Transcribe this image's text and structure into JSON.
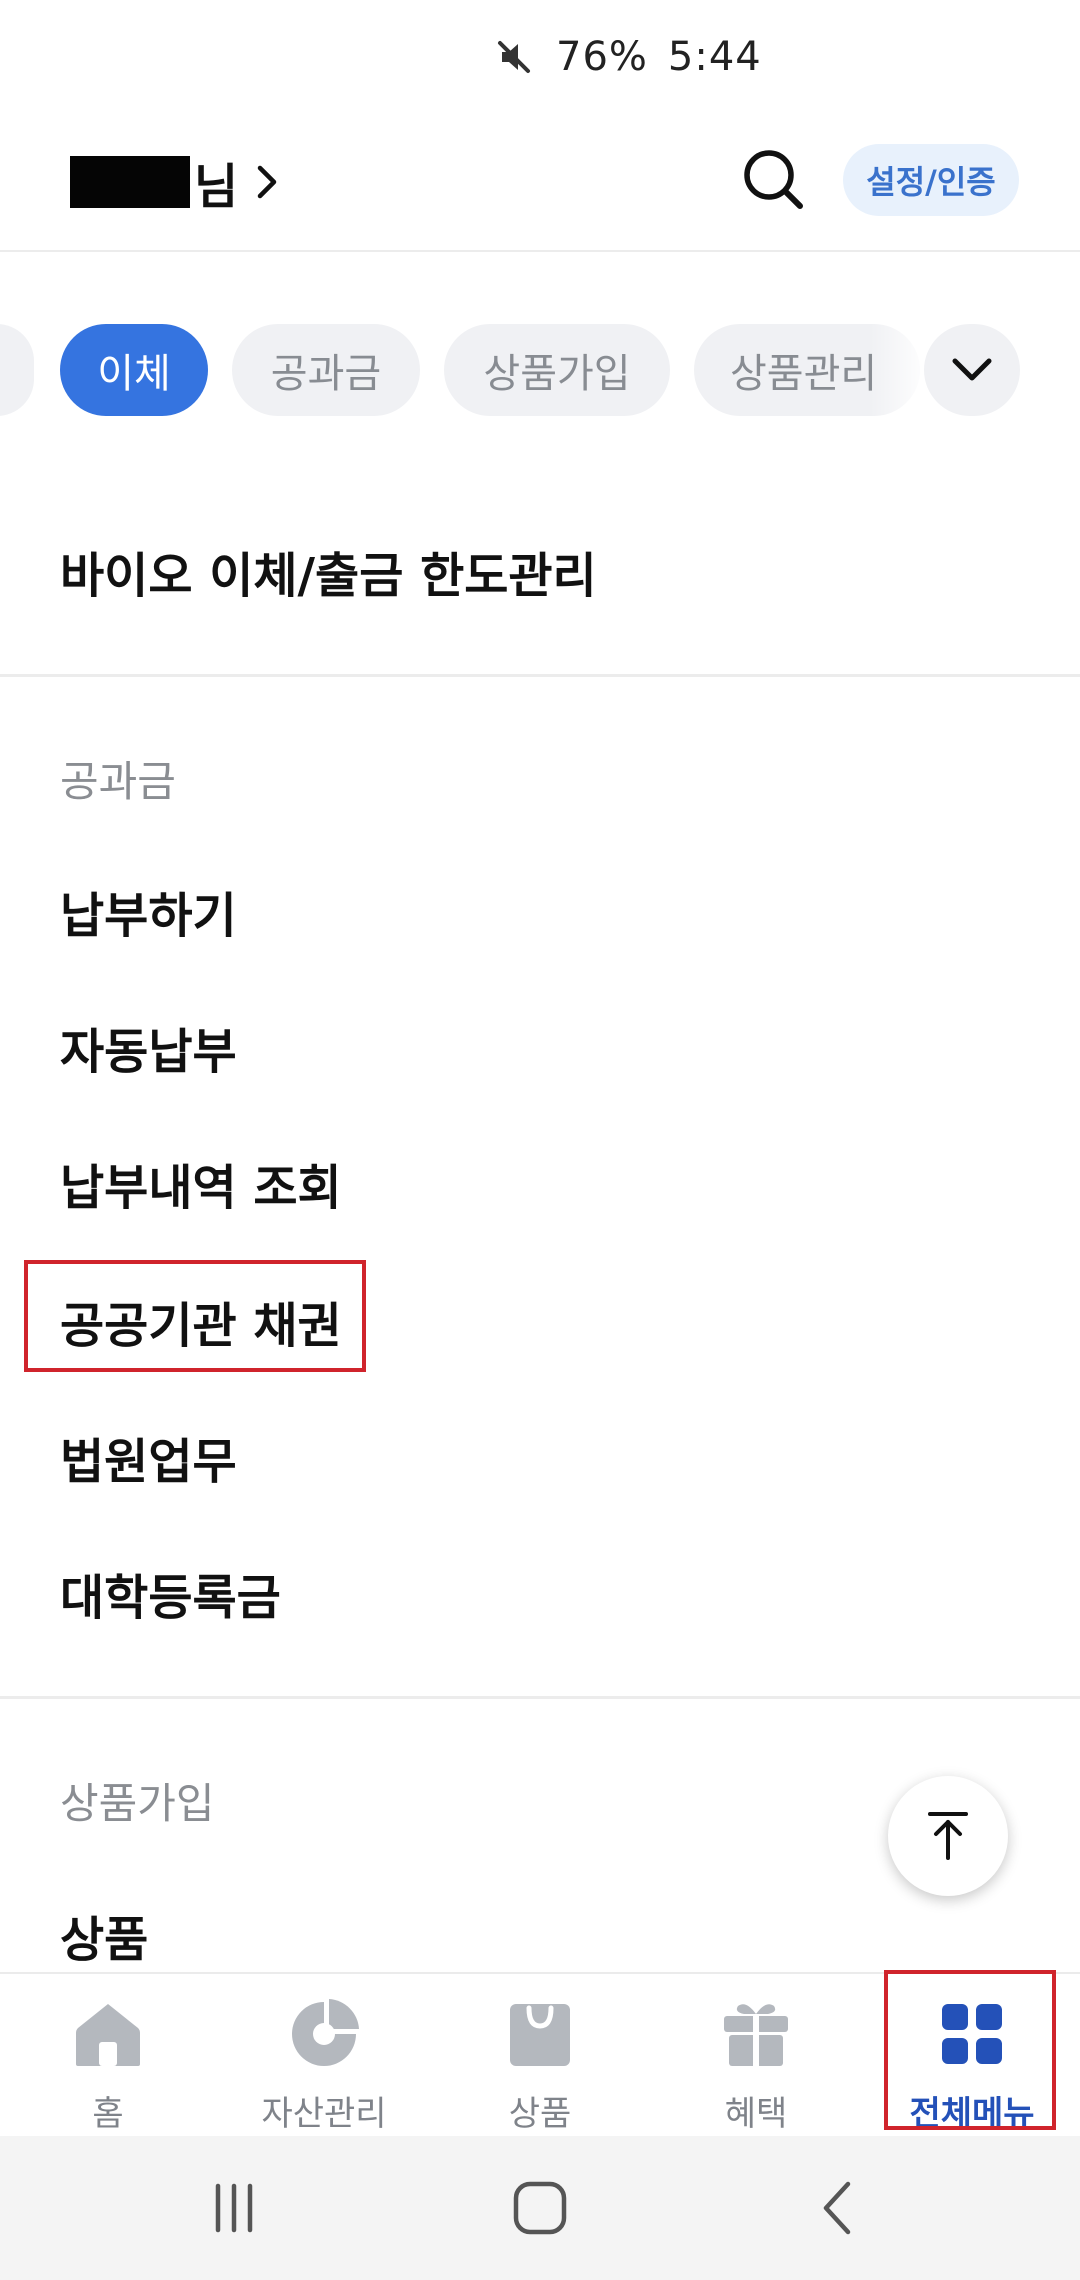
{
  "status_bar": {
    "battery": "76%",
    "time": "5:44",
    "icons": [
      "mute-icon"
    ]
  },
  "header": {
    "user_suffix": "님",
    "settings_label": "설정/인증",
    "icons": [
      "search-icon",
      "chevron-right-icon"
    ]
  },
  "category_tabs": [
    {
      "label": "이체",
      "active": true
    },
    {
      "label": "공과금",
      "active": false
    },
    {
      "label": "상품가입",
      "active": false
    },
    {
      "label": "상품관리",
      "active": false
    }
  ],
  "transfer_section": {
    "items": [
      "바이오 이체/출금 한도관리"
    ]
  },
  "utility_section": {
    "title": "공과금",
    "items": [
      "납부하기",
      "자동납부",
      "납부내역 조회",
      "공공기관 채권",
      "법원업무",
      "대학등록금"
    ]
  },
  "product_section": {
    "title": "상품가입",
    "items": [
      "상품"
    ]
  },
  "bottom_nav": [
    {
      "label": "홈",
      "icon": "home-icon",
      "active": false
    },
    {
      "label": "자산관리",
      "icon": "pie-chart-icon",
      "active": false
    },
    {
      "label": "상품",
      "icon": "shopping-bag-icon",
      "active": false
    },
    {
      "label": "혜택",
      "icon": "gift-icon",
      "active": false
    },
    {
      "label": "전체메뉴",
      "icon": "grid-menu-icon",
      "active": true
    }
  ],
  "colors": {
    "accent": "#3574e0",
    "active_nav": "#2451b8",
    "highlight": "#d0242c"
  }
}
